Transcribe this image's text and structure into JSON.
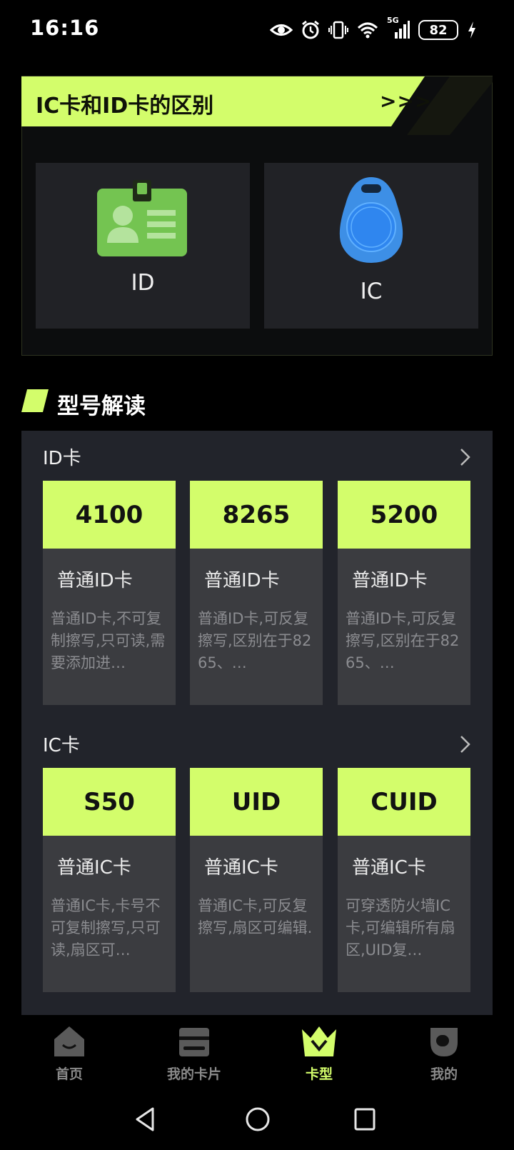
{
  "status_bar": {
    "time": "16:16",
    "network": "5G",
    "battery": "82",
    "icons": [
      "eye-icon",
      "alarm-icon",
      "vibrate-icon",
      "wifi-icon",
      "signal-icon",
      "battery-icon",
      "charging-icon"
    ]
  },
  "banner": {
    "title": "IC卡和ID卡的区别",
    "arrows": ">>>",
    "tiles": [
      {
        "label": "ID",
        "icon": "id-badge-icon"
      },
      {
        "label": "IC",
        "icon": "key-fob-icon"
      }
    ]
  },
  "section": {
    "title": "型号解读"
  },
  "groups": [
    {
      "title": "ID卡",
      "cards": [
        {
          "model": "4100",
          "name": "普通ID卡",
          "desc": "普通ID卡,不可复制擦写,只可读,需要添加进…"
        },
        {
          "model": "8265",
          "name": "普通ID卡",
          "desc": "普通ID卡,可反复擦写,区别在于8265、…"
        },
        {
          "model": "5200",
          "name": "普通ID卡",
          "desc": "普通ID卡,可反复擦写,区别在于8265、…"
        }
      ]
    },
    {
      "title": "IC卡",
      "cards": [
        {
          "model": "S50",
          "name": "普通IC卡",
          "desc": "普通IC卡,卡号不可复制擦写,只可读,扇区可…"
        },
        {
          "model": "UID",
          "name": "普通IC卡",
          "desc": "普通IC卡,可反复擦写,扇区可编辑."
        },
        {
          "model": "CUID",
          "name": "普通IC卡",
          "desc": "可穿透防火墙IC卡,可编辑所有扇区,UID复…"
        }
      ]
    }
  ],
  "bottom_nav": {
    "items": [
      {
        "label": "首页",
        "icon": "home-icon",
        "active": false
      },
      {
        "label": "我的卡片",
        "icon": "wallet-icon",
        "active": false
      },
      {
        "label": "卡型",
        "icon": "crown-icon",
        "active": true
      },
      {
        "label": "我的",
        "icon": "profile-icon",
        "active": false
      }
    ]
  },
  "system_nav": {
    "icons": [
      "back-icon",
      "home-circle-icon",
      "recents-icon"
    ]
  },
  "colors": {
    "accent": "#d3fd6b",
    "background": "#000000",
    "panel": "#22242b",
    "card": "#3b3c40",
    "tile": "#212226"
  }
}
